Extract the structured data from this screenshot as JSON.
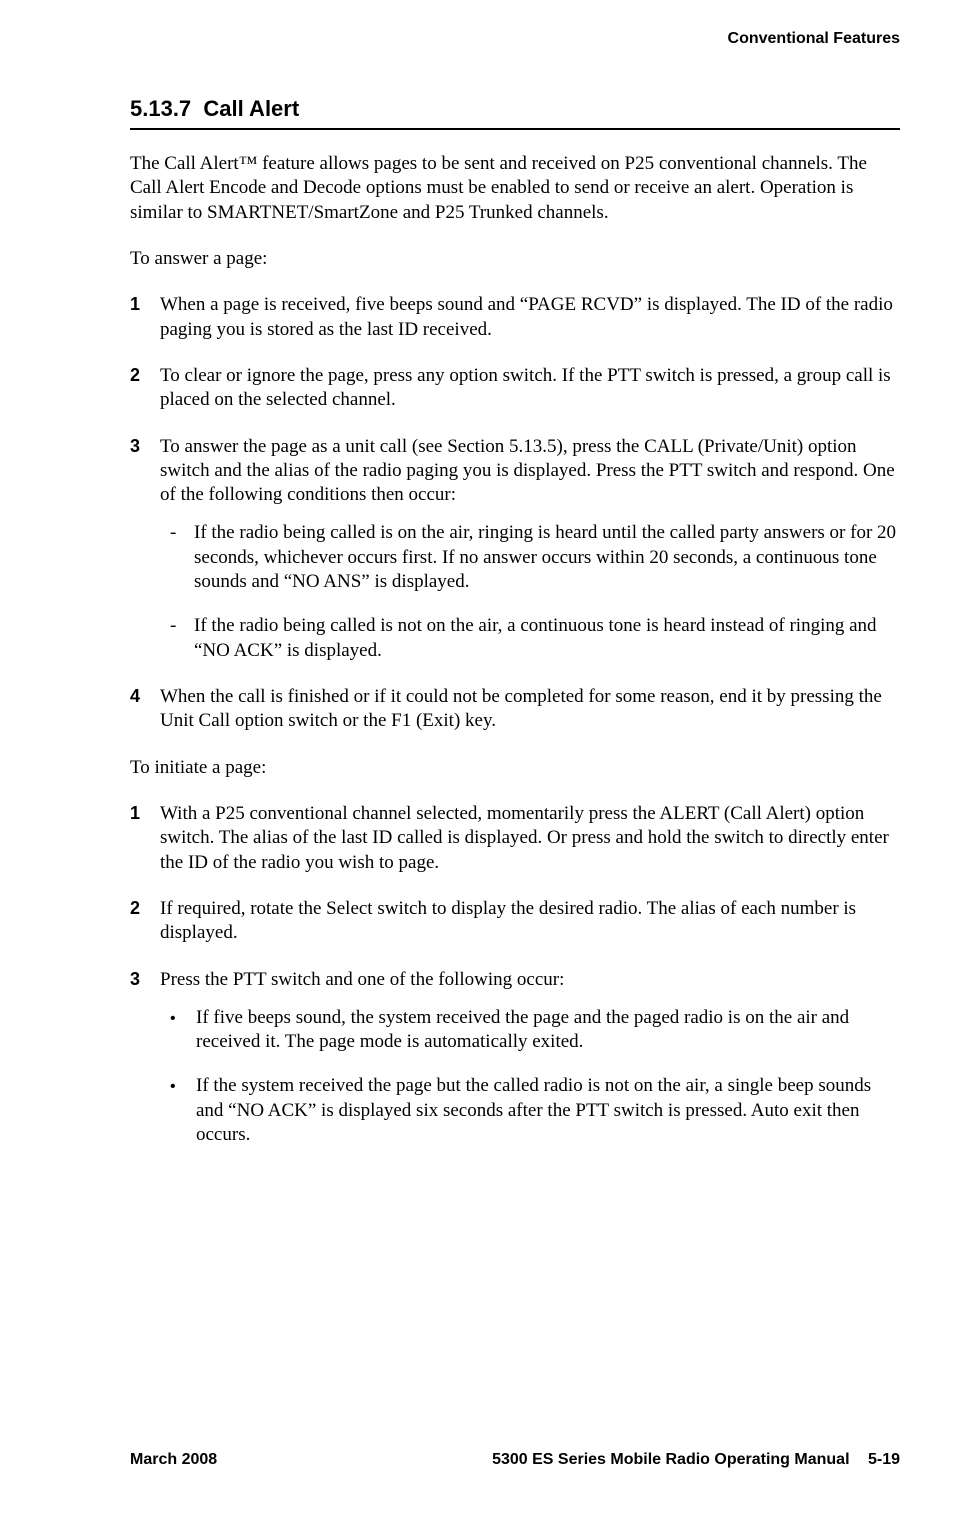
{
  "header": {
    "chapter": "Conventional Features"
  },
  "section": {
    "number": "5.13.7",
    "title": "Call Alert",
    "intro": "The Call Alert™ feature allows pages to be sent and received on P25 conventional channels. The Call Alert Encode and Decode options must be enabled to send or receive an alert. Operation is similar to SMARTNET/SmartZone and P25 Trunked channels."
  },
  "answer": {
    "lead": "To answer a page:",
    "steps": [
      {
        "n": "1",
        "text": "When a page is received, five beeps sound and “PAGE RCVD” is displayed. The ID of the radio paging you is stored as the last ID received."
      },
      {
        "n": "2",
        "text": "To clear or ignore the page, press any option switch. If the PTT switch is pressed, a group call is placed on the selected channel."
      },
      {
        "n": "3",
        "text": "To answer the page as a unit call (see Section 5.13.5), press the CALL (Private/Unit) option switch and the alias of the radio paging you is displayed. Press the PTT switch and respond. One of the following conditions then occur:",
        "sub": [
          "If the radio being called is on the air, ringing is heard until the called party answers or for 20 seconds, whichever occurs first. If no answer occurs within 20 seconds, a continuous tone sounds and “NO ANS” is displayed.",
          "If the radio being called is not on the air, a continuous tone is heard instead of ringing and “NO ACK” is displayed."
        ]
      },
      {
        "n": "4",
        "text": "When the call is finished or if it could not be completed for some reason, end it by pressing the Unit Call option switch or the F1 (Exit) key."
      }
    ]
  },
  "initiate": {
    "lead": "To initiate a page:",
    "steps": [
      {
        "n": "1",
        "text": "With a P25 conventional channel selected, momentarily press the ALERT (Call Alert) option switch. The alias of the last ID called is displayed. Or press and hold the switch to directly enter the ID of the radio you wish to page."
      },
      {
        "n": "2",
        "text": "If required, rotate the Select switch to display the desired radio. The alias of each number is displayed."
      },
      {
        "n": "3",
        "text": "Press the PTT switch and one of the following occur:",
        "sub": [
          "If five beeps sound, the system received the page and the paged radio is on the air and received it. The page mode is automatically exited.",
          "If the system received the page but the called radio is not on the air, a single beep sounds and “NO ACK” is displayed six seconds after the PTT switch is pressed. Auto exit then occurs."
        ]
      }
    ]
  },
  "footer": {
    "date": "March 2008",
    "manual": "5300 ES Series Mobile Radio Operating Manual",
    "page": "5-19"
  }
}
